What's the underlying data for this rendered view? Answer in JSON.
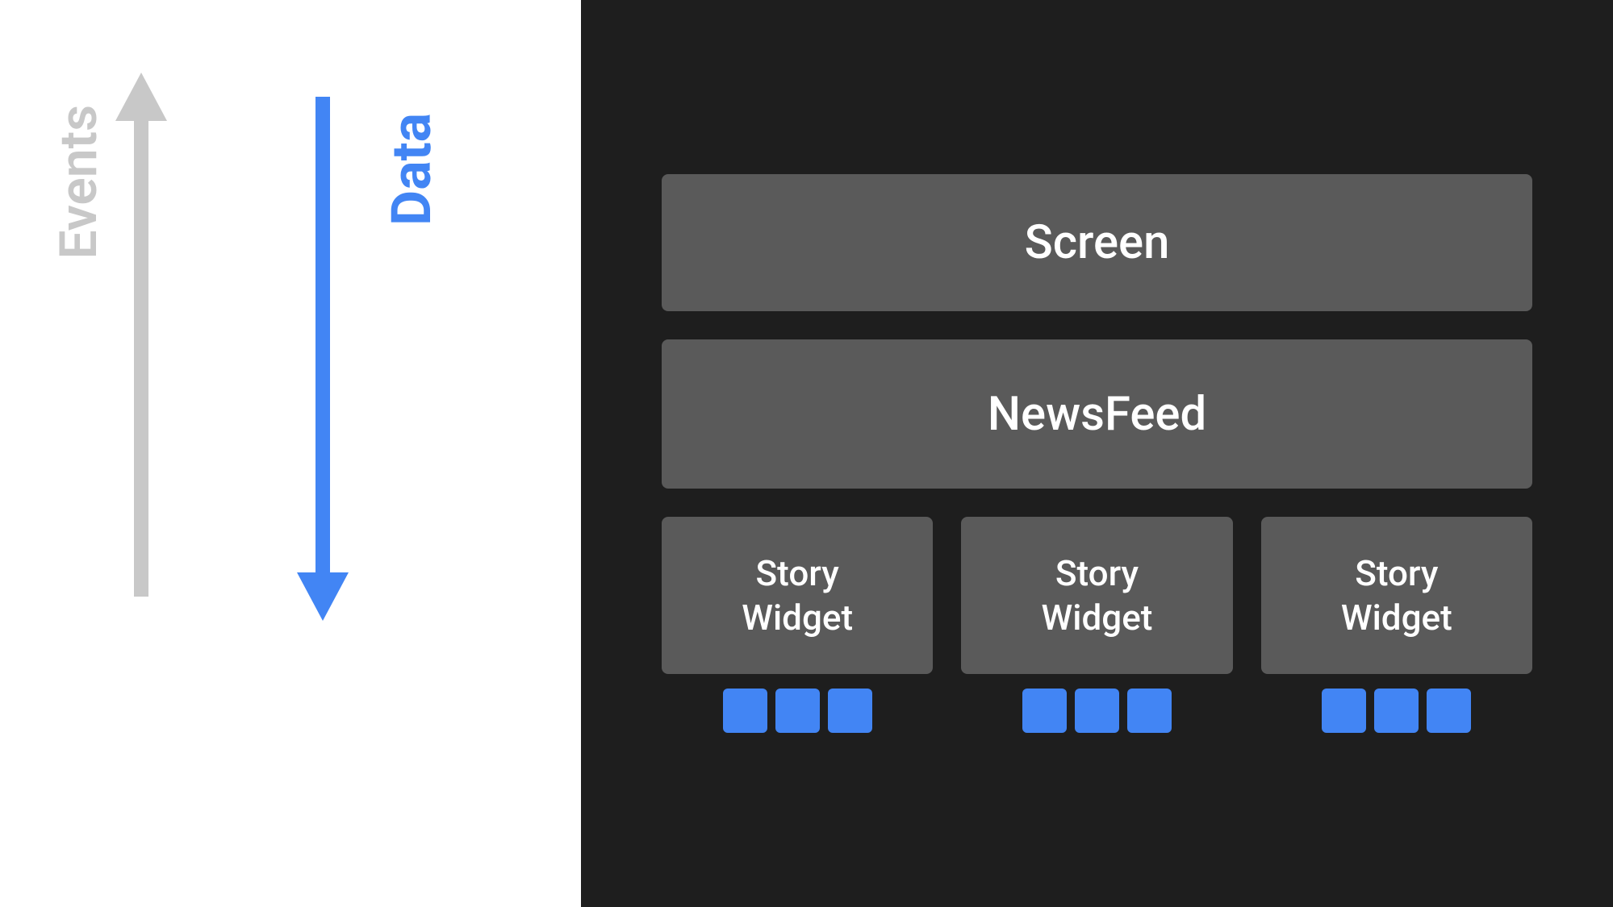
{
  "left": {
    "events_label": "Events",
    "data_label": "Data"
  },
  "right": {
    "screen_label": "Screen",
    "newsfeed_label": "NewsFeed",
    "story_widgets": [
      {
        "label": "Story\nWidget",
        "dots": 3
      },
      {
        "label": "Story\nWidget",
        "dots": 3
      },
      {
        "label": "Story\nWidget",
        "dots": 3
      }
    ]
  },
  "colors": {
    "blue": "#4285f4",
    "gray_arrow": "#c8c8c8",
    "dark_bg": "#1e1e1e",
    "box_bg": "#5a5a5a",
    "white_bg": "#ffffff",
    "white_text": "#ffffff"
  }
}
